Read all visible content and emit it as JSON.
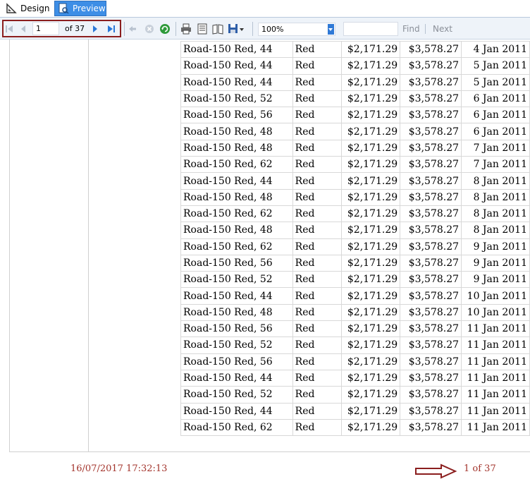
{
  "tabs": [
    {
      "label": "Design",
      "icon": "design-icon"
    },
    {
      "label": "Preview",
      "icon": "preview-icon"
    }
  ],
  "toolbar": {
    "page_input": "1",
    "page_of": "of  37",
    "zoom": "100%",
    "find_label": "Find",
    "next_label": "Next",
    "buttons": [
      "first-page-icon",
      "prev-page-icon",
      "next-page-icon",
      "last-page-icon",
      "back-icon",
      "stop-icon",
      "refresh-icon",
      "print-icon",
      "print-layout-icon",
      "page-setup-icon",
      "export-icon"
    ]
  },
  "rows": [
    {
      "product": "Road-150 Red, 44",
      "color": "Red",
      "cost": "$2,171.29",
      "price": "$3,578.27",
      "date": "4 Jan 2011"
    },
    {
      "product": "Road-150 Red, 44",
      "color": "Red",
      "cost": "$2,171.29",
      "price": "$3,578.27",
      "date": "5 Jan 2011"
    },
    {
      "product": "Road-150 Red, 44",
      "color": "Red",
      "cost": "$2,171.29",
      "price": "$3,578.27",
      "date": "5 Jan 2011"
    },
    {
      "product": "Road-150 Red, 52",
      "color": "Red",
      "cost": "$2,171.29",
      "price": "$3,578.27",
      "date": "6 Jan 2011"
    },
    {
      "product": "Road-150 Red, 56",
      "color": "Red",
      "cost": "$2,171.29",
      "price": "$3,578.27",
      "date": "6 Jan 2011"
    },
    {
      "product": "Road-150 Red, 48",
      "color": "Red",
      "cost": "$2,171.29",
      "price": "$3,578.27",
      "date": "6 Jan 2011"
    },
    {
      "product": "Road-150 Red, 48",
      "color": "Red",
      "cost": "$2,171.29",
      "price": "$3,578.27",
      "date": "7 Jan 2011"
    },
    {
      "product": "Road-150 Red, 62",
      "color": "Red",
      "cost": "$2,171.29",
      "price": "$3,578.27",
      "date": "7 Jan 2011"
    },
    {
      "product": "Road-150 Red, 44",
      "color": "Red",
      "cost": "$2,171.29",
      "price": "$3,578.27",
      "date": "8 Jan 2011"
    },
    {
      "product": "Road-150 Red, 48",
      "color": "Red",
      "cost": "$2,171.29",
      "price": "$3,578.27",
      "date": "8 Jan 2011"
    },
    {
      "product": "Road-150 Red, 62",
      "color": "Red",
      "cost": "$2,171.29",
      "price": "$3,578.27",
      "date": "8 Jan 2011"
    },
    {
      "product": "Road-150 Red, 48",
      "color": "Red",
      "cost": "$2,171.29",
      "price": "$3,578.27",
      "date": "8 Jan 2011"
    },
    {
      "product": "Road-150 Red, 62",
      "color": "Red",
      "cost": "$2,171.29",
      "price": "$3,578.27",
      "date": "9 Jan 2011"
    },
    {
      "product": "Road-150 Red, 56",
      "color": "Red",
      "cost": "$2,171.29",
      "price": "$3,578.27",
      "date": "9 Jan 2011"
    },
    {
      "product": "Road-150 Red, 52",
      "color": "Red",
      "cost": "$2,171.29",
      "price": "$3,578.27",
      "date": "9 Jan 2011"
    },
    {
      "product": "Road-150 Red, 44",
      "color": "Red",
      "cost": "$2,171.29",
      "price": "$3,578.27",
      "date": "10 Jan 2011"
    },
    {
      "product": "Road-150 Red, 48",
      "color": "Red",
      "cost": "$2,171.29",
      "price": "$3,578.27",
      "date": "10 Jan 2011"
    },
    {
      "product": "Road-150 Red, 56",
      "color": "Red",
      "cost": "$2,171.29",
      "price": "$3,578.27",
      "date": "11 Jan 2011"
    },
    {
      "product": "Road-150 Red, 52",
      "color": "Red",
      "cost": "$2,171.29",
      "price": "$3,578.27",
      "date": "11 Jan 2011"
    },
    {
      "product": "Road-150 Red, 56",
      "color": "Red",
      "cost": "$2,171.29",
      "price": "$3,578.27",
      "date": "11 Jan 2011"
    },
    {
      "product": "Road-150 Red, 44",
      "color": "Red",
      "cost": "$2,171.29",
      "price": "$3,578.27",
      "date": "11 Jan 2011"
    },
    {
      "product": "Road-150 Red, 52",
      "color": "Red",
      "cost": "$2,171.29",
      "price": "$3,578.27",
      "date": "11 Jan 2011"
    },
    {
      "product": "Road-150 Red, 44",
      "color": "Red",
      "cost": "$2,171.29",
      "price": "$3,578.27",
      "date": "11 Jan 2011"
    },
    {
      "product": "Road-150 Red, 62",
      "color": "Red",
      "cost": "$2,171.29",
      "price": "$3,578.27",
      "date": "11 Jan 2011"
    }
  ],
  "footer": {
    "timestamp": "16/07/2017 17:32:13",
    "page_of": "1 of 37"
  },
  "colors": {
    "accent": "#3d8ee6",
    "footer_text": "#a3342c",
    "highlight_border": "#8b1e1e"
  }
}
